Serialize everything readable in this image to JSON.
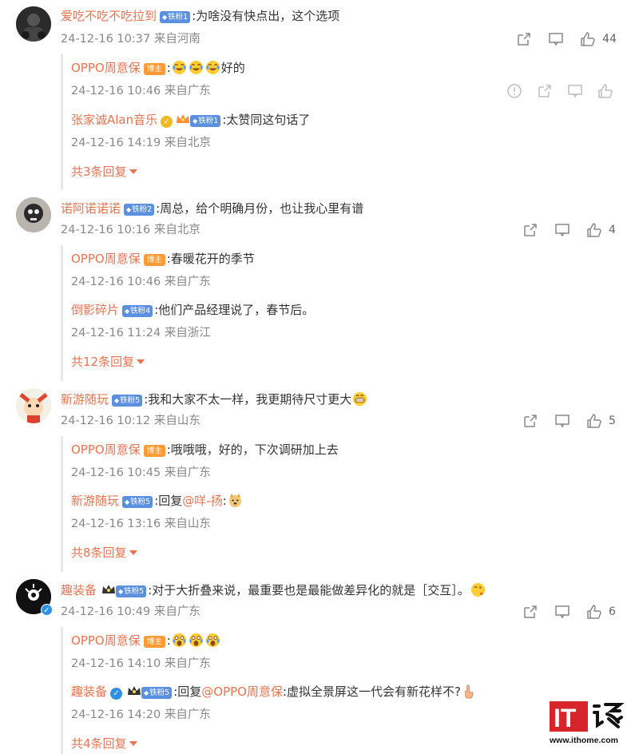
{
  "comments": [
    {
      "user": "爱吃不吃不吃拉到",
      "fan_badge": "铁粉1",
      "text": ":为啥没有快点出，这个选项",
      "meta": "24-12-16 10:37 来自河南",
      "likes": "44",
      "replies": [
        {
          "user": "OPPO周意保",
          "role": "博主",
          "text_after": "好的",
          "meta": "24-12-16 10:46 来自广东"
        },
        {
          "user": "张家诚Alan音乐",
          "fan_badge": "铁粉1",
          "text": ":太赞同这句话了",
          "meta": "24-12-16 14:19 来自北京"
        }
      ],
      "more": "共3条回复"
    },
    {
      "user": "诺阿诺诺诺",
      "fan_badge": "铁粉2",
      "text": ":周总，给个明确月份，也让我心里有谱",
      "meta": "24-12-16 10:16 来自北京",
      "likes": "4",
      "replies": [
        {
          "user": "OPPO周意保",
          "role": "博主",
          "text": ":春暖花开的季节",
          "meta": "24-12-16 10:46 来自广东"
        },
        {
          "user": "倒影碎片",
          "fan_badge": "铁粉4",
          "text": ":他们产品经理说了，春节后。",
          "meta": "24-12-16 11:24 来自浙江"
        }
      ],
      "more": "共12条回复"
    },
    {
      "user": "新游随玩",
      "fan_badge": "铁粉5",
      "text": ":我和大家不太一样，我更期待尺寸更大",
      "meta": "24-12-16 10:12 来自山东",
      "likes": "5",
      "replies": [
        {
          "user": "OPPO周意保",
          "role": "博主",
          "text": ":哦哦哦，好的，下次调研加上去",
          "meta": "24-12-16 10:45 来自广东"
        },
        {
          "user": "新游随玩",
          "fan_badge": "铁粉5",
          "text_pre": ":回复",
          "mention": "@咩-扬",
          "text_post": ":",
          "meta": "24-12-16 13:16 来自山东"
        }
      ],
      "more": "共8条回复"
    },
    {
      "user": "趣装备",
      "fan_badge": "铁粉5",
      "text": ":对于大折叠来说，最重要也是最能做差异化的就是［交互］。",
      "meta": "24-12-16 10:49 来自广东",
      "likes": "6",
      "replies": [
        {
          "user": "OPPO周意保",
          "role": "博主",
          "text": ":",
          "meta": "24-12-16 14:10 来自广东"
        },
        {
          "user": "趣装备",
          "fan_badge": "铁粉5",
          "text_pre": ":回复",
          "mention": "@OPPO周意保",
          "text_post": ":虚拟全景屏这一代会有新花样不?",
          "meta": "24-12-16 14:20 来自广东"
        }
      ],
      "more": "共4条回复"
    }
  ],
  "watermark": {
    "site": "www.ithome.com",
    "logo_text": "IT"
  }
}
